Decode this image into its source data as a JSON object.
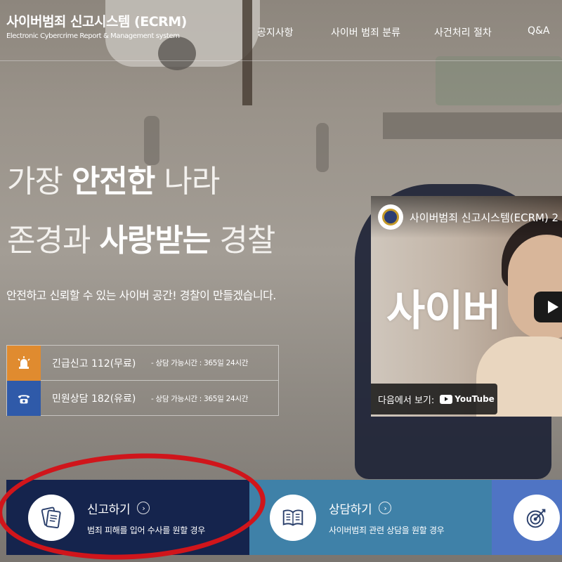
{
  "header": {
    "title": "사이버범죄 신고시스템 (ECRM)",
    "subtitle": "Electronic Cybercrime Report & Management system",
    "nav": [
      "공지사항",
      "사이버 범죄 분류",
      "사건처리 절차",
      "Q&A"
    ]
  },
  "hero": {
    "line1_a": "가장 ",
    "line1_b": "안전한",
    "line1_c": " 나라",
    "line2_a": "존경과 ",
    "line2_b": "사랑받는",
    "line2_c": " 경찰",
    "subtitle": "안전하고 신뢰할 수 있는 사이버 공간! 경찰이 만들겠습니다."
  },
  "contacts": [
    {
      "icon": "siren-icon",
      "label": "긴급신고 112(무료)",
      "hours": "- 상담 가능시간 : 365일 24시간",
      "color": "#e08b2f"
    },
    {
      "icon": "phone-icon",
      "label": "민원상담 182(유료)",
      "hours": "- 상담 가능시간 : 365일 24시간",
      "color": "#2f5aa9"
    }
  ],
  "video": {
    "title": "사이버범죄 신고시스템(ECRM) 2",
    "overlay_text": "사이버",
    "watch_on": "다음에서 보기:",
    "platform": "YouTube"
  },
  "cards": [
    {
      "title": "신고하기",
      "desc": "범죄 피해를 입어 수사를 원할 경우",
      "color": "#15244d",
      "icon": "report-icon"
    },
    {
      "title": "상담하기",
      "desc": "사이버범죄 관련 상담을 원할 경우",
      "color": "#3f81a8",
      "icon": "book-icon"
    },
    {
      "title": "",
      "desc": "",
      "color": "#4f74c4",
      "icon": "target-icon"
    }
  ],
  "colors": {
    "annotation": "#d0151b"
  }
}
